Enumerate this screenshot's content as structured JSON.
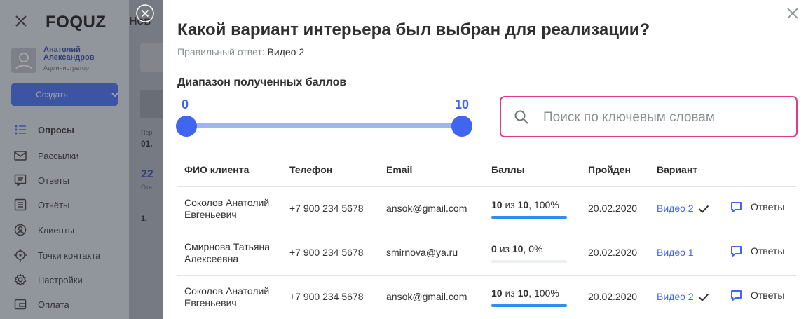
{
  "sidebar": {
    "logo": "FOQUZ",
    "user_name_line1": "Анатолий",
    "user_name_line2": "Александров",
    "user_role": "Администратор",
    "create_label": "Создать",
    "items": [
      {
        "label": "Опросы",
        "icon": "list-icon",
        "active": true
      },
      {
        "label": "Рассылки",
        "icon": "envelope-icon"
      },
      {
        "label": "Ответы",
        "icon": "chat-icon"
      },
      {
        "label": "Отчёты",
        "icon": "report-icon"
      },
      {
        "label": "Клиенты",
        "icon": "user-circle-icon"
      },
      {
        "label": "Точки контакта",
        "icon": "target-icon"
      },
      {
        "label": "Настройки",
        "icon": "gear-icon"
      },
      {
        "label": "Оплата",
        "icon": "wallet-icon"
      }
    ]
  },
  "background": {
    "fragment_title": "Нов",
    "fragment_small": "Пер",
    "fragment_date": "01.",
    "fragment_number": "22",
    "fragment_sub": "Отв",
    "fragment_item": "1."
  },
  "modal": {
    "title": "Какой вариант интерьера был выбран для реализации?",
    "answer_label": "Правильный ответ:",
    "answer_value": "Видео 2",
    "range_title": "Диапазон полученных баллов",
    "range_min": "0",
    "range_max": "10",
    "search_placeholder": "Поиск по ключевым словам"
  },
  "table": {
    "headers": [
      "ФИО клиента",
      "Телефон",
      "Email",
      "Баллы",
      "Пройден",
      "Вариант"
    ],
    "rows": [
      {
        "name_line1": "Соколов Анатолий",
        "name_line2": "Евгеньевич",
        "phone": "+7 900 234 5678",
        "email": "ansok@gmail.com",
        "score": "10",
        "of": "из",
        "max": "10",
        "percent": "100%",
        "fill": 1.0,
        "date": "20.02.2020",
        "variant": "Видео 2",
        "checked": true,
        "answers_label": "Ответы"
      },
      {
        "name_line1": "Смирнова Татьяна",
        "name_line2": "Алексеевна",
        "phone": "+7 900 234 5678",
        "email": "smirnova@ya.ru",
        "score": "0",
        "of": "из",
        "max": "10",
        "percent": "0%",
        "fill": 0.0,
        "date": "20.02.2020",
        "variant": "Видео 1",
        "checked": false,
        "answers_label": "Ответы"
      },
      {
        "name_line1": "Соколов Анатолий",
        "name_line2": "Евгеньевич",
        "phone": "+7 900 234 5678",
        "email": "ansok@gmail.com",
        "score": "10",
        "of": "из",
        "max": "10",
        "percent": "100%",
        "fill": 1.0,
        "date": "20.02.2020",
        "variant": "Видео 2",
        "checked": true,
        "answers_label": "Ответы"
      }
    ]
  },
  "colors": {
    "accent": "#3f65f1",
    "search_border": "#e03a8d",
    "progress": "#2f8ff0"
  }
}
